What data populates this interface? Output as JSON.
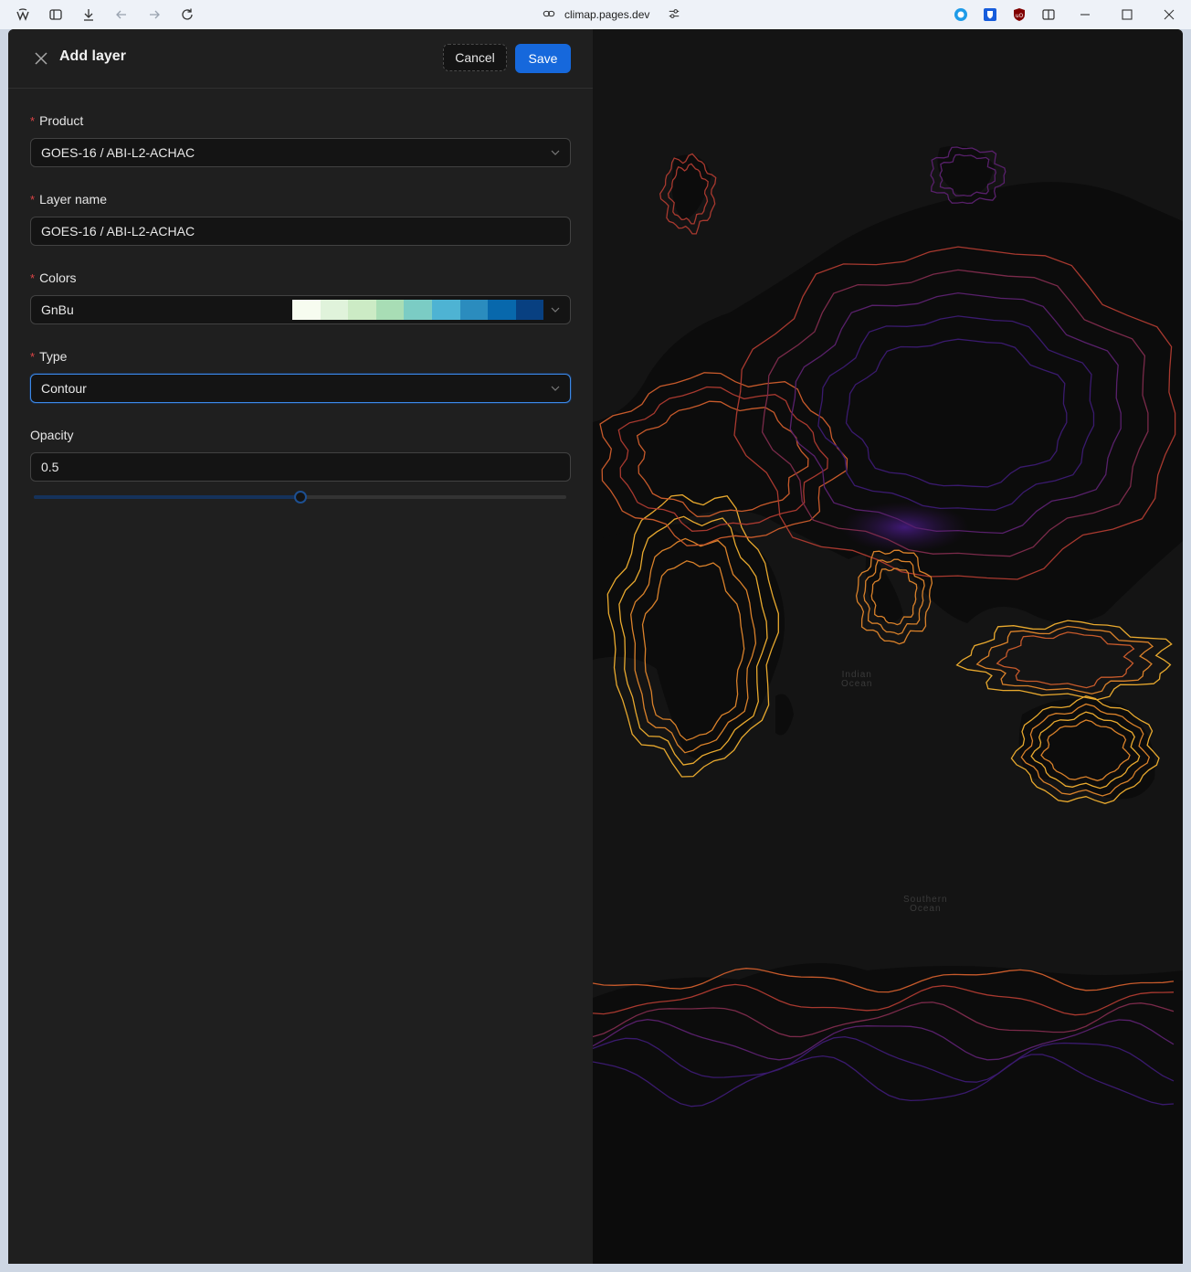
{
  "browser": {
    "url": "climap.pages.dev",
    "icons": [
      "app-logo-icon",
      "sidebar-toggle-icon",
      "download-icon",
      "back-icon",
      "forward-icon",
      "reload-icon",
      "link-icon",
      "site-settings-icon",
      "extension-ring-icon",
      "bitwarden-shield-icon",
      "ublock-origin-icon",
      "split-view-icon",
      "minimize-icon",
      "maximize-icon",
      "close-window-icon"
    ]
  },
  "panel": {
    "title": "Add layer",
    "cancel_label": "Cancel",
    "save_label": "Save",
    "required_mark": "*",
    "fields": {
      "product": {
        "label": "Product",
        "value": "GOES-16 / ABI-L2-ACHAC"
      },
      "layer_name": {
        "label": "Layer name",
        "value": "GOES-16 / ABI-L2-ACHAC"
      },
      "colors": {
        "label": "Colors",
        "value": "GnBu",
        "swatches": [
          "#f7fcf0",
          "#e0f3db",
          "#ccebc5",
          "#a8ddb5",
          "#7bccc4",
          "#4eb3d3",
          "#2b8cbe",
          "#0868ac",
          "#084081"
        ]
      },
      "type": {
        "label": "Type",
        "value": "Contour"
      },
      "opacity": {
        "label": "Opacity",
        "value": "0.5",
        "fraction": 0.5
      }
    }
  },
  "map": {
    "labels": {
      "indian_ocean": "Indian\nOcean",
      "southern_ocean": "Southern\nOcean"
    },
    "contour_colors": [
      "#e8a92e",
      "#d9812a",
      "#c75a2b",
      "#a8392f",
      "#7a2a4a",
      "#58206b",
      "#3a1a6e"
    ]
  }
}
